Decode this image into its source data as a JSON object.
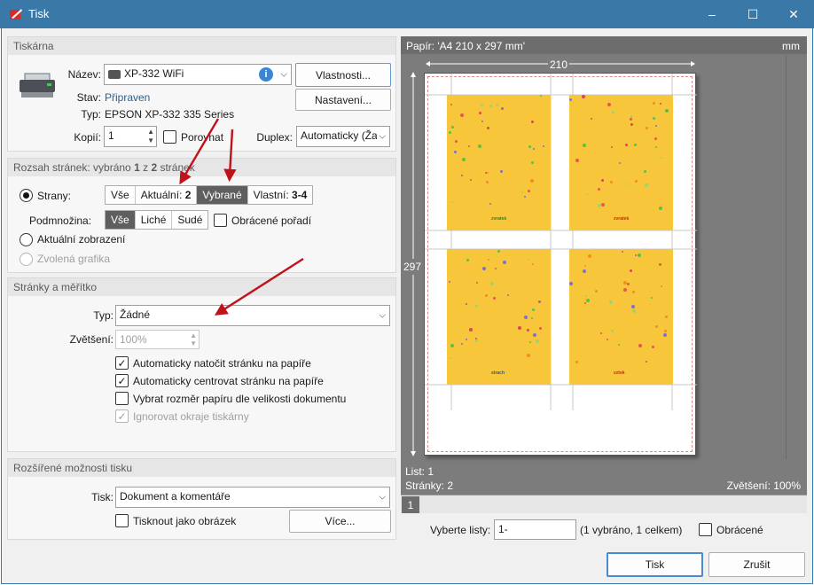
{
  "window": {
    "title": "Tisk",
    "minimize": "–",
    "maximize": "☐",
    "close": "✕"
  },
  "printer": {
    "section_title": "Tiskárna",
    "name_label": "Název:",
    "name_value": "XP-332 WiFi",
    "properties_button": "Vlastnosti...",
    "settings_button": "Nastavení...",
    "status_label": "Stav:",
    "status_value": "Připraven",
    "type_label": "Typ:",
    "type_value": "EPSON XP-332 335 Series",
    "copies_label": "Kopií:",
    "copies_value": "1",
    "collate_label": "Porovnat",
    "duplex_label": "Duplex:",
    "duplex_value": "Automaticky (Ža"
  },
  "range": {
    "section_title_prefix": "Rozsah stránek: vybráno ",
    "section_selected": "1",
    "section_mid": " z ",
    "section_total": "2",
    "section_suffix": " stránek",
    "pages_label": "Strany:",
    "pages_options": [
      "Vše",
      "Aktuální: 2",
      "Vybrané",
      "Vlastní: 3-4"
    ],
    "pages_selected": "Vybrané",
    "subset_label": "Podmnožina:",
    "subset_options": [
      "Vše",
      "Liché",
      "Sudé"
    ],
    "subset_selected": "Vše",
    "reverse_label": "Obrácené pořadí",
    "current_view_label": "Aktuální zobrazení",
    "selected_graphic_label": "Zvolená grafika"
  },
  "scale": {
    "section_title": "Stránky a měřítko",
    "type_label": "Typ:",
    "type_value": "Žádné",
    "zoom_label": "Zvětšení:",
    "zoom_value": "100%",
    "options": [
      {
        "label": "Automaticky natočit stránku na papíře",
        "checked": true,
        "disabled": false
      },
      {
        "label": "Automaticky centrovat stránku na papíře",
        "checked": true,
        "disabled": false
      },
      {
        "label": "Vybrat rozměr papíru dle velikosti dokumentu",
        "checked": false,
        "disabled": false
      },
      {
        "label": "Ignorovat okraje tiskárny",
        "checked": true,
        "disabled": true
      }
    ]
  },
  "advanced": {
    "section_title": "Rozšířené možnosti tisku",
    "print_label": "Tisk:",
    "print_value": "Dokument a komentáře",
    "as_image_label": "Tisknout jako obrázek",
    "more_button": "Více..."
  },
  "preview": {
    "paper_label": "Papír: 'A4 210 x 297 mm'",
    "units": "mm",
    "width_label": "210",
    "height_label": "297",
    "sheet_label": "List: 1",
    "pages_label": "Stránky: 2",
    "zoom_label": "Zvětšení: 100%",
    "page_tab": "1",
    "tile_labels": [
      "zvratek",
      "zvratek",
      "strach",
      "vztek"
    ],
    "tile_label_colors": [
      "#1a8a3a",
      "#d42020",
      "#1a5fa0",
      "#d42020"
    ]
  },
  "sheets": {
    "label": "Vyberte listy:",
    "value": "1-",
    "info": "(1 vybráno, 1 celkem)",
    "reverse_label": "Obrácené"
  },
  "footer": {
    "print_button": "Tisk",
    "cancel_button": "Zrušit"
  },
  "colors": {
    "titlebar": "#3a78a8",
    "selected_segment": "#5f5f5f",
    "annotation_arrow": "#c0121b",
    "tile_background": "#f8c63a"
  }
}
